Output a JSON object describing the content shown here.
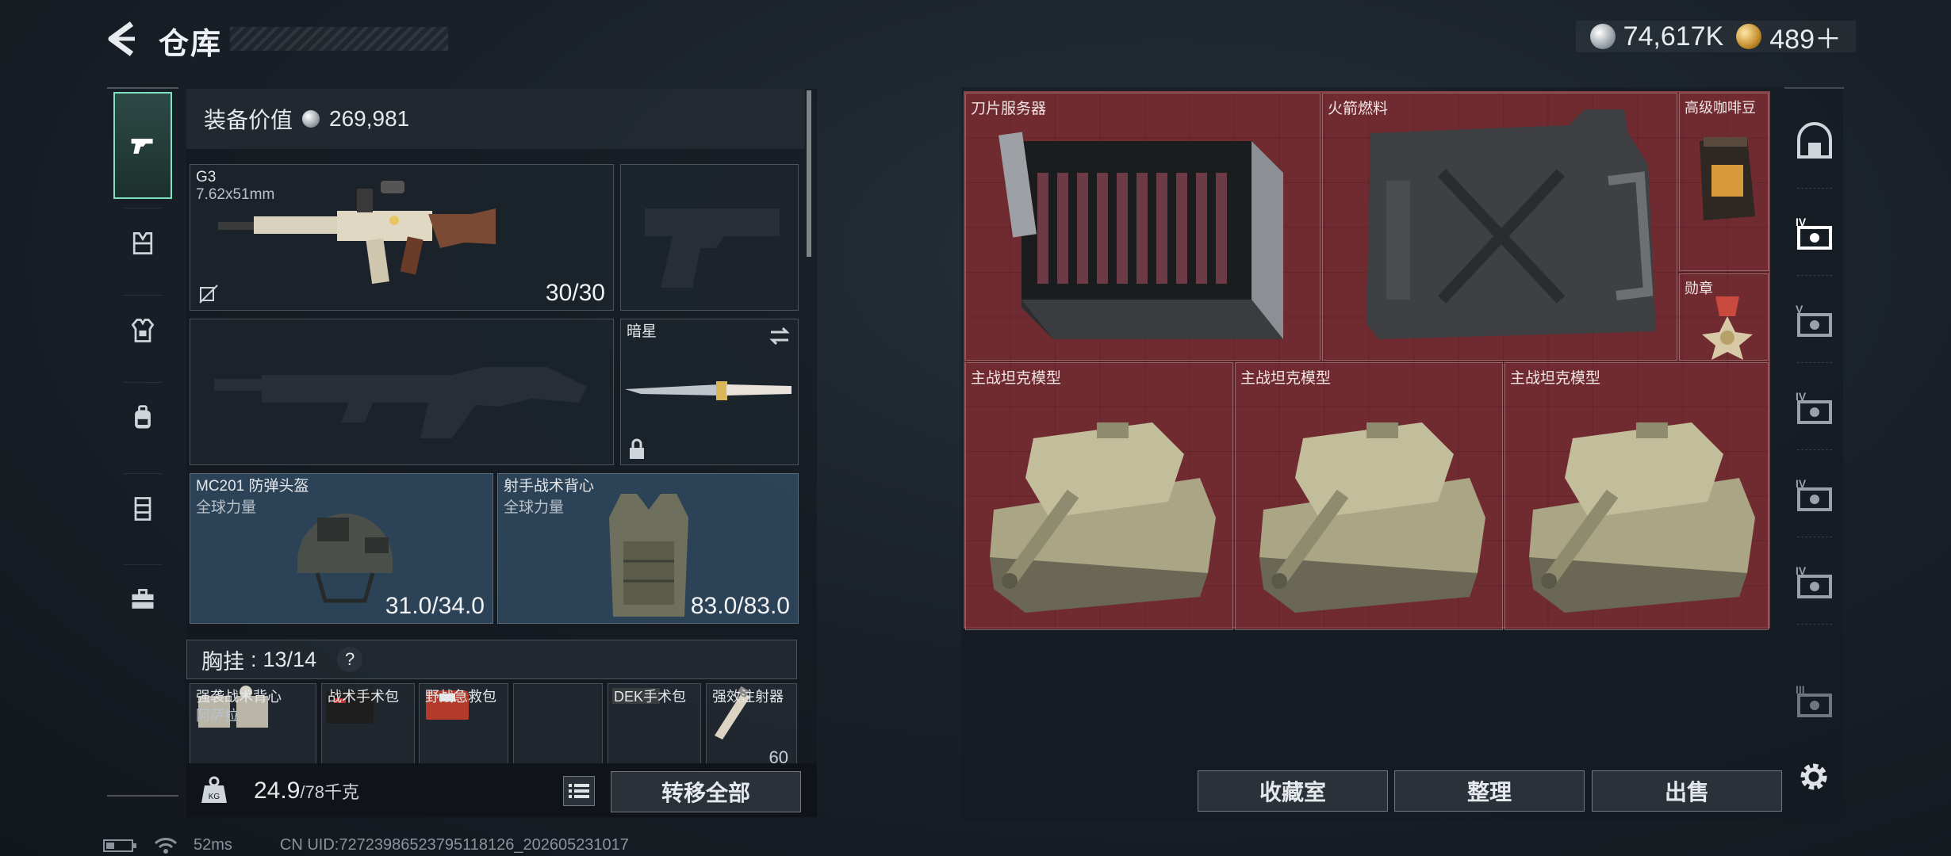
{
  "header": {
    "title": "仓库",
    "silver_amount": "74,617K",
    "gold_amount": "489＋"
  },
  "left_rail": {
    "tabs": [
      {
        "icon": "pistol-icon",
        "active": true
      },
      {
        "icon": "vest-icon"
      },
      {
        "icon": "armor-icon"
      },
      {
        "icon": "backpack-icon"
      },
      {
        "icon": "locker-icon"
      },
      {
        "icon": "briefcase-icon"
      }
    ]
  },
  "loadout": {
    "equip_value_label": "装备价值",
    "equip_value": "269,981",
    "primary_weapon": {
      "name": "G3",
      "caliber": "7.62x51mm",
      "ammo": "30/30"
    },
    "melee": {
      "name": "暗星"
    },
    "helmet": {
      "name": "MC201 防弹头盔",
      "maker": "全球力量",
      "durability": "31.0/34.0"
    },
    "body_armor": {
      "name": "射手战术背心",
      "maker": "全球力量",
      "durability": "83.0/83.0"
    },
    "chest_rig_label": "胸挂",
    "chest_rig_capacity": "13/14",
    "chest_rig_help": "?",
    "chest_items": [
      {
        "name": "强袭战术背心",
        "sub": "阿萨拉"
      },
      {
        "name": "战术手术包",
        "sub": ""
      },
      {
        "name": "野战急救包",
        "sub": ""
      },
      {
        "name": "",
        "sub": ""
      },
      {
        "name": "DEK手术包",
        "sub": ""
      },
      {
        "name": "强效注射器",
        "sub": ""
      }
    ],
    "injector_count": "60"
  },
  "bottom_left": {
    "weight_current": "24.9",
    "weight_max": "/78千克",
    "transfer_all": "转移全部"
  },
  "stash": {
    "items": [
      {
        "name": "刀片服务器"
      },
      {
        "name": "火箭燃料"
      },
      {
        "name": "高级咖啡豆"
      },
      {
        "name": "勋章"
      },
      {
        "name": "主战坦克模型"
      },
      {
        "name": "主战坦克模型"
      },
      {
        "name": "主战坦克模型"
      }
    ],
    "buttons": {
      "collection": "收藏室",
      "organize": "整理",
      "sell": "出售"
    }
  },
  "right_rail": {
    "tabs": [
      "stash-main-icon",
      "stash-tier-IV-icon",
      "stash-tier-V-icon",
      "stash-tier-IV-icon",
      "stash-tier-IV-icon",
      "stash-tier-IV-icon",
      "stash-tier-III-icon"
    ]
  },
  "status": {
    "ping": "52ms",
    "uid": "CN UID:7272398652379511812​6_202605231017"
  },
  "colors": {
    "accent": "#7fe0c0",
    "stash_bg": "#6b2a2f",
    "armor_slot": "#34506a"
  }
}
